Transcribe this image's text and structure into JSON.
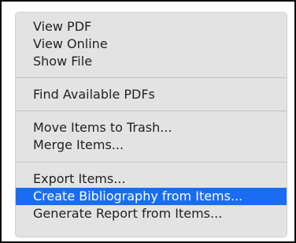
{
  "context_menu": {
    "highlight_color": "#1a6df3",
    "items": [
      {
        "label": "View PDF"
      },
      {
        "label": "View Online"
      },
      {
        "label": "Show File"
      },
      {
        "label": "Find Available PDFs"
      },
      {
        "label": "Move Items to Trash..."
      },
      {
        "label": "Merge Items..."
      },
      {
        "label": "Export Items..."
      },
      {
        "label": "Create Bibliography from Items...",
        "highlighted": true
      },
      {
        "label": "Generate Report from Items..."
      }
    ]
  }
}
